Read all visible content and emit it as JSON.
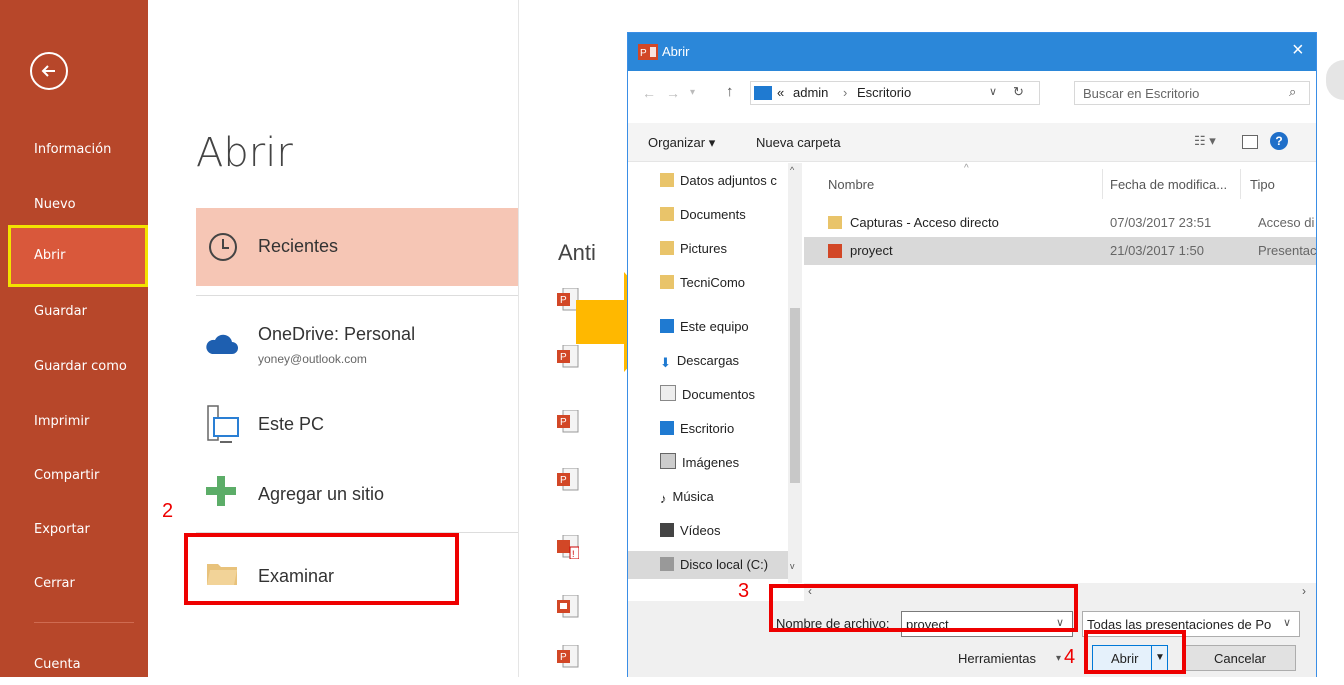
{
  "backstage": {
    "nav": [
      "Información",
      "Nuevo",
      "Abrir",
      "Guardar",
      "Guardar como",
      "Imprimir",
      "Compartir",
      "Exportar",
      "Cerrar",
      "Cuenta"
    ]
  },
  "open_pane": {
    "title": "Abrir",
    "recent_label": "Recientes",
    "onedrive_label": "OneDrive: Personal",
    "onedrive_email": "yoney@outlook.com",
    "thispc_label": "Este PC",
    "addsite_label": "Agregar un sitio",
    "browse_label": "Examinar",
    "cut_heading": "Anti"
  },
  "steps": {
    "browse": "2",
    "filename": "3",
    "open": "4"
  },
  "dialog": {
    "title": "Abrir",
    "breadcrumb": {
      "prefix": "«",
      "parts": [
        "admin",
        "Escritorio"
      ]
    },
    "search_placeholder": "Buscar en Escritorio",
    "organize_label": "Organizar ▾",
    "new_folder_label": "Nueva carpeta",
    "tree": [
      "Datos adjuntos c",
      "Documents",
      "Pictures",
      "TecniComo",
      "Este equipo",
      "Descargas",
      "Documentos",
      "Escritorio",
      "Imágenes",
      "Música",
      "Vídeos",
      "Disco local (C:)"
    ],
    "columns": [
      "Nombre",
      "Fecha de modifica...",
      "Tipo"
    ],
    "files": [
      {
        "name": "Capturas - Acceso directo",
        "date": "07/03/2017 23:51",
        "type": "Acceso di"
      },
      {
        "name": "proyect",
        "date": "21/03/2017 1:50",
        "type": "Presentac"
      }
    ],
    "filename_label": "Nombre de archivo:",
    "filename_value": "proyect",
    "filter_value": "Todas las presentaciones de Po",
    "tools_label": "Herramientas",
    "open_label": "Abrir",
    "cancel_label": "Cancelar"
  },
  "colors": {
    "backstage": "#b7472a",
    "active": "#d9583b",
    "highlight": "#f3e300",
    "arrow": "#ffb800",
    "title_bar": "#2b87d9",
    "annotation": "#ee0000"
  }
}
